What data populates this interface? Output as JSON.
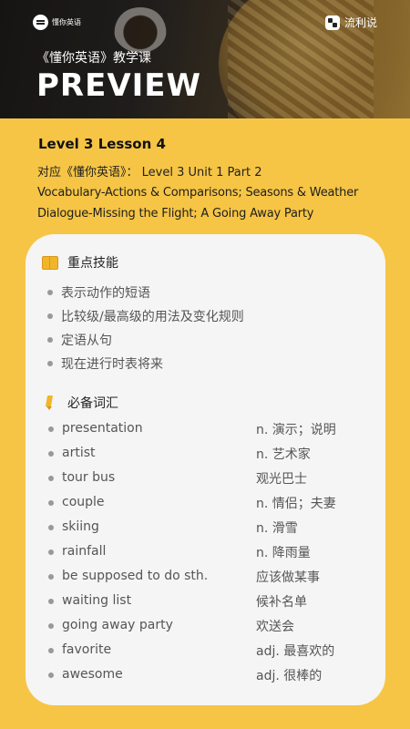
{
  "header": {
    "brand_text": "懂你英语",
    "app_name": "流利说",
    "course_title": "《懂你英语》教学课",
    "preview": "PREVIEW"
  },
  "lesson": {
    "title": "Level 3 Lesson 4",
    "correspondence": "对应《懂你英语》： Level 3 Unit 1 Part 2",
    "line1": "Vocabulary-Actions & Comparisons; Seasons & Weather",
    "line2": "Dialogue-Missing the Flight; A Going Away Party"
  },
  "skills": {
    "heading": "重点技能",
    "icon": "book-icon",
    "items": [
      "表示动作的短语",
      "比较级/最高级的用法及变化规则",
      "定语从句",
      "现在进行时表将来"
    ]
  },
  "vocab": {
    "heading": "必备词汇",
    "icon": "pen-icon",
    "items": [
      {
        "word": "presentation",
        "meaning": "n. 演示；说明"
      },
      {
        "word": "artist",
        "meaning": "n. 艺术家"
      },
      {
        "word": "tour bus",
        "meaning": "观光巴士"
      },
      {
        "word": "couple",
        "meaning": "n. 情侣；夫妻"
      },
      {
        "word": "skiing",
        "meaning": "n. 滑雪"
      },
      {
        "word": "rainfall",
        "meaning": "n. 降雨量"
      },
      {
        "word": "be supposed to do sth.",
        "meaning": "应该做某事"
      },
      {
        "word": "waiting list",
        "meaning": "候补名单"
      },
      {
        "word": "going away party",
        "meaning": "欢送会"
      },
      {
        "word": "favorite",
        "meaning": "adj. 最喜欢的"
      },
      {
        "word": "awesome",
        "meaning": "adj. 很棒的"
      }
    ]
  },
  "colors": {
    "background": "#f6c545",
    "card": "#f5f5f5",
    "accent": "#f1b52a"
  }
}
